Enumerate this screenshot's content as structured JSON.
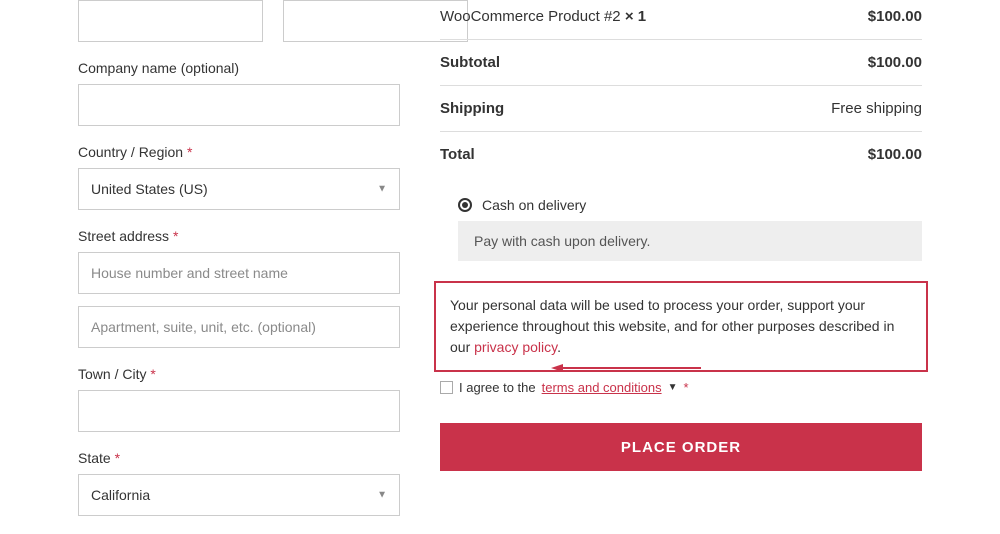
{
  "billing": {
    "company_label": "Company name (optional)",
    "country_label": "Country / Region",
    "country_value": "United States (US)",
    "street_label": "Street address",
    "street_placeholder1": "House number and street name",
    "street_placeholder2": "Apartment, suite, unit, etc. (optional)",
    "city_label": "Town / City",
    "state_label": "State",
    "state_value": "California"
  },
  "order": {
    "product_name": "WooCommerce Product #2 ",
    "product_qty": "× 1",
    "product_price": "$100.00",
    "subtotal_label": "Subtotal",
    "subtotal_value": "$100.00",
    "shipping_label": "Shipping",
    "shipping_value": "Free shipping",
    "total_label": "Total",
    "total_value": "$100.00"
  },
  "payment": {
    "method_label": "Cash on delivery",
    "method_desc": "Pay with cash upon delivery."
  },
  "privacy": {
    "text_before": "Your personal data will be used to process your order, support your experience throughout this website, and for other purposes described in our ",
    "link": "privacy policy",
    "text_after": "."
  },
  "terms": {
    "prefix": "I agree to the ",
    "link": "terms and conditions",
    "asterisk": "*"
  },
  "button": {
    "place_order": "PLACE ORDER"
  }
}
